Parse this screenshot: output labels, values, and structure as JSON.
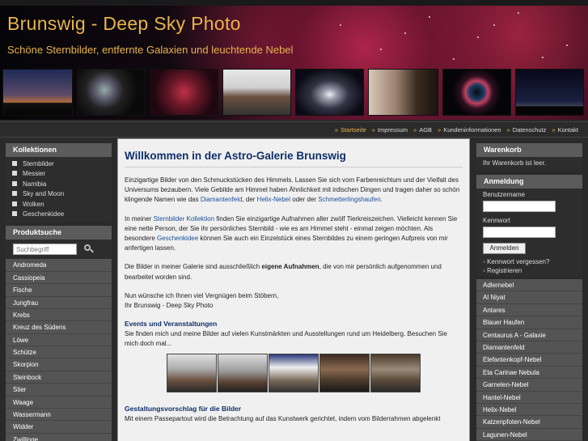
{
  "header": {
    "title": "Brunswig - Deep Sky Photo",
    "subtitle": "Schöne Sternbilder, entfernte Galaxien und leuchtende Nebel"
  },
  "topnav": [
    "Startseite",
    "Impressum",
    "AGB",
    "Kundeninformationen",
    "Datenschutz",
    "Kontakt"
  ],
  "left": {
    "collections_title": "Kollektionen",
    "collections": [
      "Sternbilder",
      "Messier",
      "Namibia",
      "Sky and Moon",
      "Wolken",
      "Geschenkidee"
    ],
    "search_title": "Produktsuche",
    "search_placeholder": "Suchbegriff",
    "constellations": [
      "Andromeda",
      "Cassiopeia",
      "Fische",
      "Jungfrau",
      "Krebs",
      "Kreuz des Südens",
      "Löwe",
      "Schütze",
      "Skorpion",
      "Steinbock",
      "Stier",
      "Waage",
      "Wassermann",
      "Widder",
      "Zwillinge"
    ]
  },
  "right": {
    "cart_title": "Warenkorb",
    "cart_text": "Ihr Warenkorb ist leer.",
    "login_title": "Anmeldung",
    "username_label": "Benutzername",
    "password_label": "Kennwort",
    "login_button": "Anmelden",
    "forgot_link": "Kennwort vergessen?",
    "register_link": "Registrieren",
    "nebulae": [
      "Adlernebel",
      "Al Niyat",
      "Antares",
      "Blauer Haufen",
      "Centaurus A - Galaxie",
      "Diamantenfeld",
      "Elefantenkopf-Nebel",
      "Eta Carinae Nebula",
      "Garnelen-Nebel",
      "Hantel-Nebel",
      "Helix-Nebel",
      "Katzenpfoten-Nebel",
      "Lagunen-Nebel"
    ]
  },
  "main": {
    "heading": "Willkommen in der Astro-Galerie Brunswig",
    "p1_a": "Einzigartige Bilder von den Schmuckstücken des Himmels. Lassen Sie sich vom Farbenreichtum und der Vielfalt des Universums bezaubern. Viele Gebilde am Himmel haben Ähnlichkeit mit irdischen Dingen und tragen daher so schön klingende Namen wie das ",
    "p1_link1": "Diamantenfeld",
    "p1_b": ", der ",
    "p1_link2": "Helix-Nebel",
    "p1_c": " oder der ",
    "p1_link3": "Schmetterlingshaufen",
    "p1_d": ".",
    "p2_a": "In meiner ",
    "p2_link1": "Sternbilder Kollektion",
    "p2_b": " finden Sie einzigartige Aufnahmen aller zwölf Tierkreiszeichen. Vielleicht kennen Sie eine nette Person, der Sie ihr persönliches Sternbild - wie es am Himmel steht - einmal zeigen möchten. Als besondere ",
    "p2_link2": "Geschenkidee",
    "p2_c": " können Sie auch ein Einzelstück eines Sternbildes zu einem geringen Aufpreis von mir anfertigen lassen.",
    "p3_a": "Die Bilder in meiner Galerie sind ausschließlich ",
    "p3_bold": "eigene Aufnahmen",
    "p3_b": ", die von mir persönlich aufgenommen und bearbeitet worden sind.",
    "p4_line1": "Nun wünsche ich Ihnen viel Vergnügen beim Stöbern,",
    "p4_line2": "Ihr Brunswig - Deep Sky Photo",
    "events_heading": "Events und Veranstaltungen",
    "events_text": "Sie finden mich und meine Bilder auf vielen Kunstmärkten und Ausstellungen rund um Heidelberg. Besuchen Sie mich doch mal...",
    "design_heading": "Gestaltungsvorschlag für die Bilder",
    "design_text": "Mit einem Passepartout wird die Betrachtung auf das Kunstwerk gerichtet, indem vom Bilderrahmen abgelenkt"
  }
}
